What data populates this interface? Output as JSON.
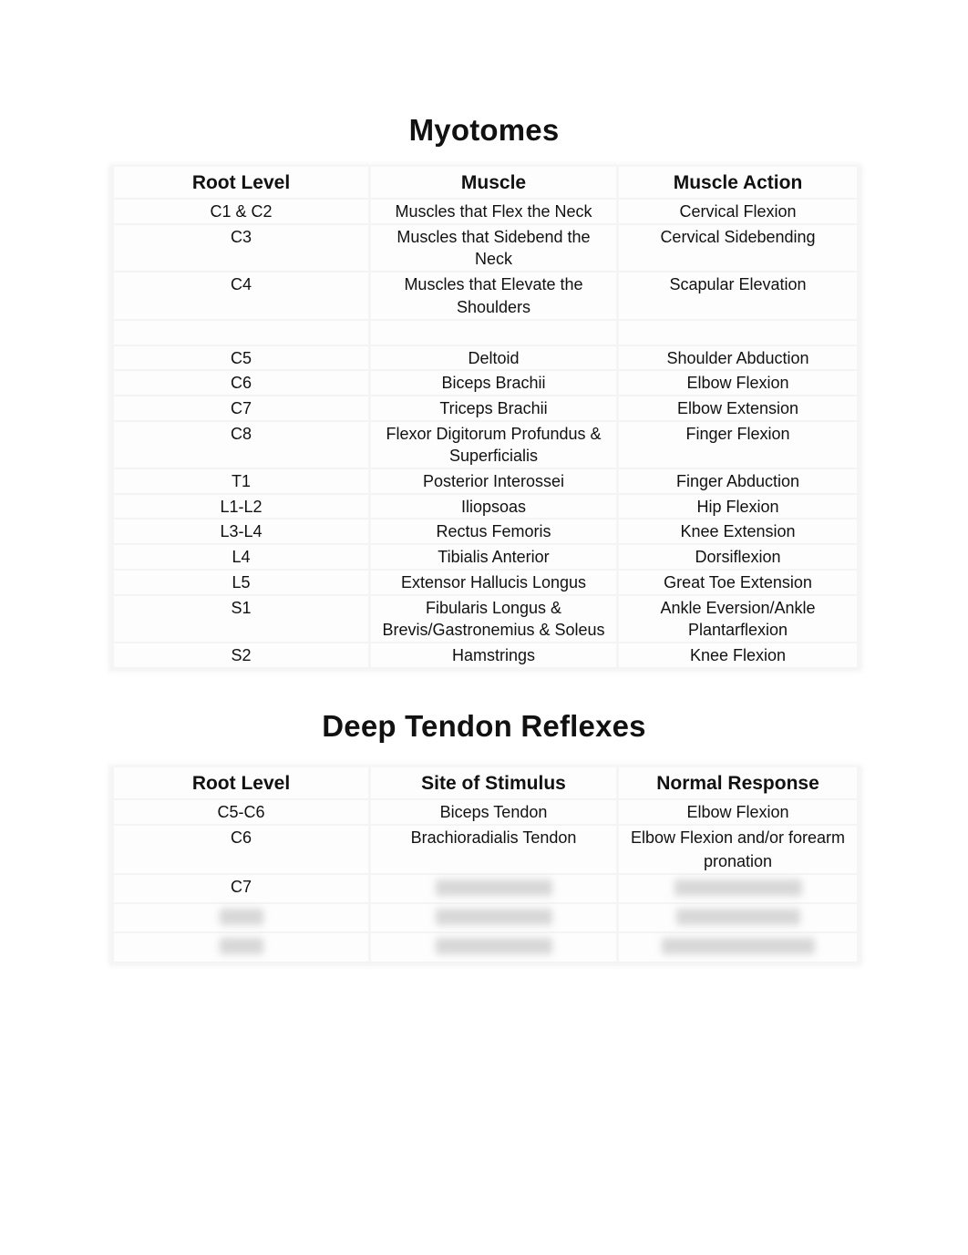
{
  "myotomes": {
    "title": "Myotomes",
    "headers": [
      "Root Level",
      "Muscle",
      "Muscle Action"
    ],
    "rows": [
      {
        "root": "C1 & C2",
        "muscle": "Muscles that Flex the Neck",
        "action": "Cervical Flexion"
      },
      {
        "root": "C3",
        "muscle": "Muscles that Sidebend the Neck",
        "action": "Cervical Sidebending"
      },
      {
        "root": "C4",
        "muscle": "Muscles that Elevate the Shoulders",
        "action": "Scapular Elevation"
      },
      {
        "root": "",
        "muscle": "",
        "action": ""
      },
      {
        "root": "C5",
        "muscle": "Deltoid",
        "action": "Shoulder Abduction"
      },
      {
        "root": "C6",
        "muscle": "Biceps Brachii",
        "action": "Elbow Flexion"
      },
      {
        "root": "C7",
        "muscle": "Triceps Brachii",
        "action": "Elbow Extension"
      },
      {
        "root": "C8",
        "muscle": "Flexor Digitorum Profundus & Superficialis",
        "action": "Finger Flexion"
      },
      {
        "root": "T1",
        "muscle": "Posterior Interossei",
        "action": "Finger Abduction"
      },
      {
        "root": "L1-L2",
        "muscle": "Iliopsoas",
        "action": "Hip Flexion"
      },
      {
        "root": "L3-L4",
        "muscle": "Rectus Femoris",
        "action": "Knee Extension"
      },
      {
        "root": "L4",
        "muscle": "Tibialis Anterior",
        "action": "Dorsiflexion"
      },
      {
        "root": "L5",
        "muscle": "Extensor Hallucis Longus",
        "action": "Great Toe Extension"
      },
      {
        "root": "S1",
        "muscle": "Fibularis Longus & Brevis/Gastronemius & Soleus",
        "action": "Ankle Eversion/Ankle Plantarflexion"
      },
      {
        "root": "S2",
        "muscle": "Hamstrings",
        "action": "Knee Flexion"
      }
    ]
  },
  "reflexes": {
    "title": "Deep Tendon Reflexes",
    "headers": [
      "Root Level",
      "Site of Stimulus",
      "Normal Response"
    ],
    "rows": [
      {
        "root": "C5-C6",
        "site": "Biceps Tendon",
        "response": "Elbow Flexion"
      },
      {
        "root": "C6",
        "site": "Brachioradialis Tendon",
        "response": "Elbow Flexion and/or forearm pronation"
      },
      {
        "root": "C7",
        "site": "",
        "response": ""
      },
      {
        "root": "",
        "site": "",
        "response": ""
      },
      {
        "root": "",
        "site": "",
        "response": ""
      }
    ],
    "obscured_cells_note": "blurred"
  }
}
